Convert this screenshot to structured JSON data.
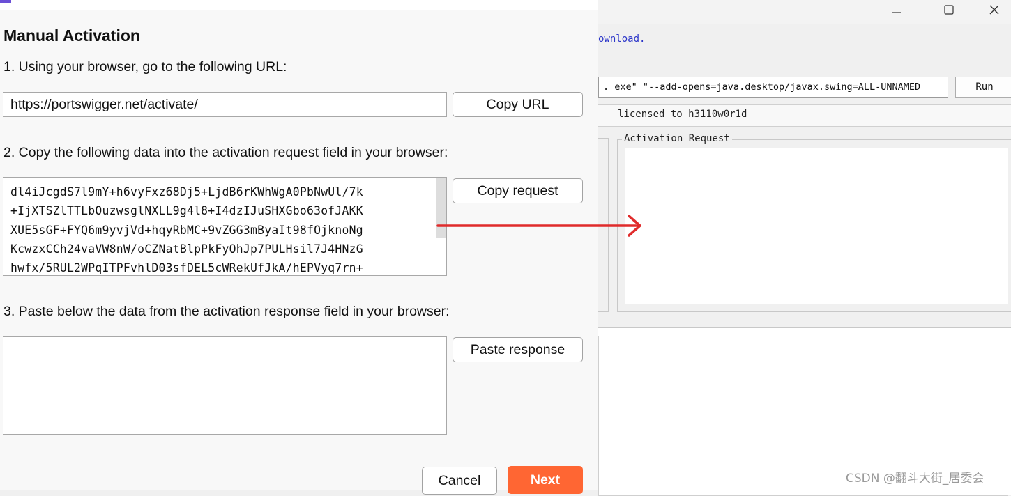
{
  "background_window": {
    "link_text": "ownload.",
    "command_field": ". exe\" \"--add-opens=java.desktop/javax.swing=ALL-UNNAMED",
    "run_label": "Run",
    "licensed_text": "licensed to h3110w0r1d",
    "activation_request_title": "Activation Request",
    "watermark": "CSDN @翻斗大街_居委会"
  },
  "dialog": {
    "heading": "Manual Activation",
    "step1": "1. Using your browser, go to the following URL:",
    "url_value": "https://portswigger.net/activate/",
    "copy_url_label": "Copy URL",
    "step2": "2. Copy the following data into the activation request field in your browser:",
    "request_lines": [
      "dl4iJcgdS7l9mY+h6vyFxz68Dj5+LjdB6rKWhWgA0PbNwUl/7k",
      "+IjXTSZlTTLbOuzwsglNXLL9g4l8+I4dzIJuSHXGbo63ofJAKK",
      "XUE5sGF+FYQ6m9yvjVd+hqyRbMC+9vZGG3mByaIt98fOjknoNg",
      "KcwzxCCh24vaVW8nW/oCZNatBlpPkFyOhJp7PULHsil7J4HNzG",
      "hwfx/5RUL2WPqITPFvhlD03sfDEL5cWRekUfJkA/hEPVyq7rn+"
    ],
    "copy_request_label": "Copy request",
    "step3": "3. Paste below the data from the activation response field in your browser:",
    "response_value": "",
    "paste_response_label": "Paste response",
    "cancel_label": "Cancel",
    "next_label": "Next"
  },
  "colors": {
    "next_button": "#ff6633",
    "arrow": "#e02b2b",
    "link": "#2b35c9"
  }
}
